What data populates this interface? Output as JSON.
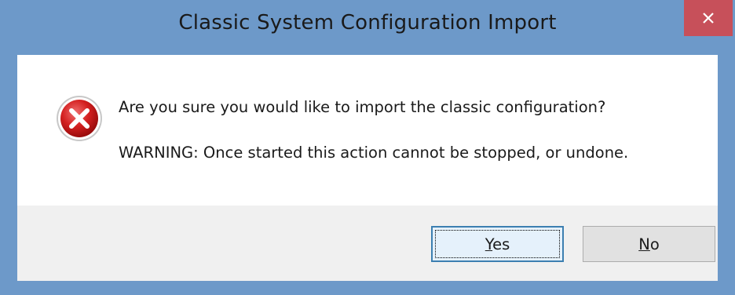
{
  "window": {
    "title": "Classic System Configuration Import",
    "close_icon": "close-icon",
    "frame_color": "#6d99c9",
    "close_color": "#c7505a"
  },
  "dialog": {
    "icon": "error-icon",
    "question": "Are you sure you would like to import the classic configuration?",
    "warning": "WARNING: Once started this action cannot be stopped, or undone."
  },
  "buttons": {
    "yes": {
      "mnemonic": "Y",
      "rest": "es"
    },
    "no": {
      "mnemonic": "N",
      "rest": "o"
    }
  }
}
